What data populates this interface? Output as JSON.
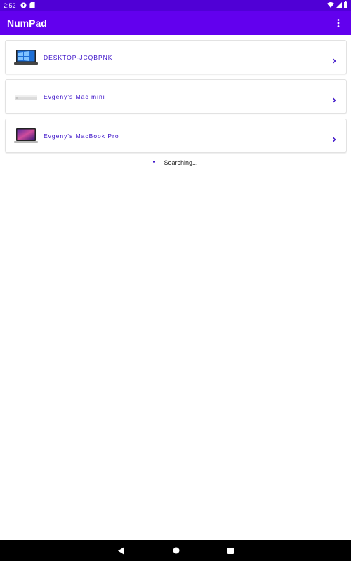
{
  "status_bar": {
    "time": "2:52",
    "icons": [
      "translate-icon",
      "sd-card-icon",
      "wifi-icon",
      "signal-icon",
      "battery-icon"
    ]
  },
  "app_bar": {
    "title": "NumPad",
    "menu_icon": "more-vert-icon",
    "color": "#6200ee"
  },
  "devices": [
    {
      "name": "DESKTOP-JCQBPNK",
      "icon": "windows-laptop-icon"
    },
    {
      "name": "Evgeny's Mac mini",
      "icon": "mac-mini-icon"
    },
    {
      "name": "Evgeny's MacBook Pro",
      "icon": "macbook-pro-icon"
    }
  ],
  "searching_text": "Searching...",
  "nav_bar": {
    "icons": [
      "back-icon",
      "home-icon",
      "recents-icon"
    ]
  },
  "colors": {
    "accent": "#3b10c8",
    "status_bar": "#5000d6"
  }
}
